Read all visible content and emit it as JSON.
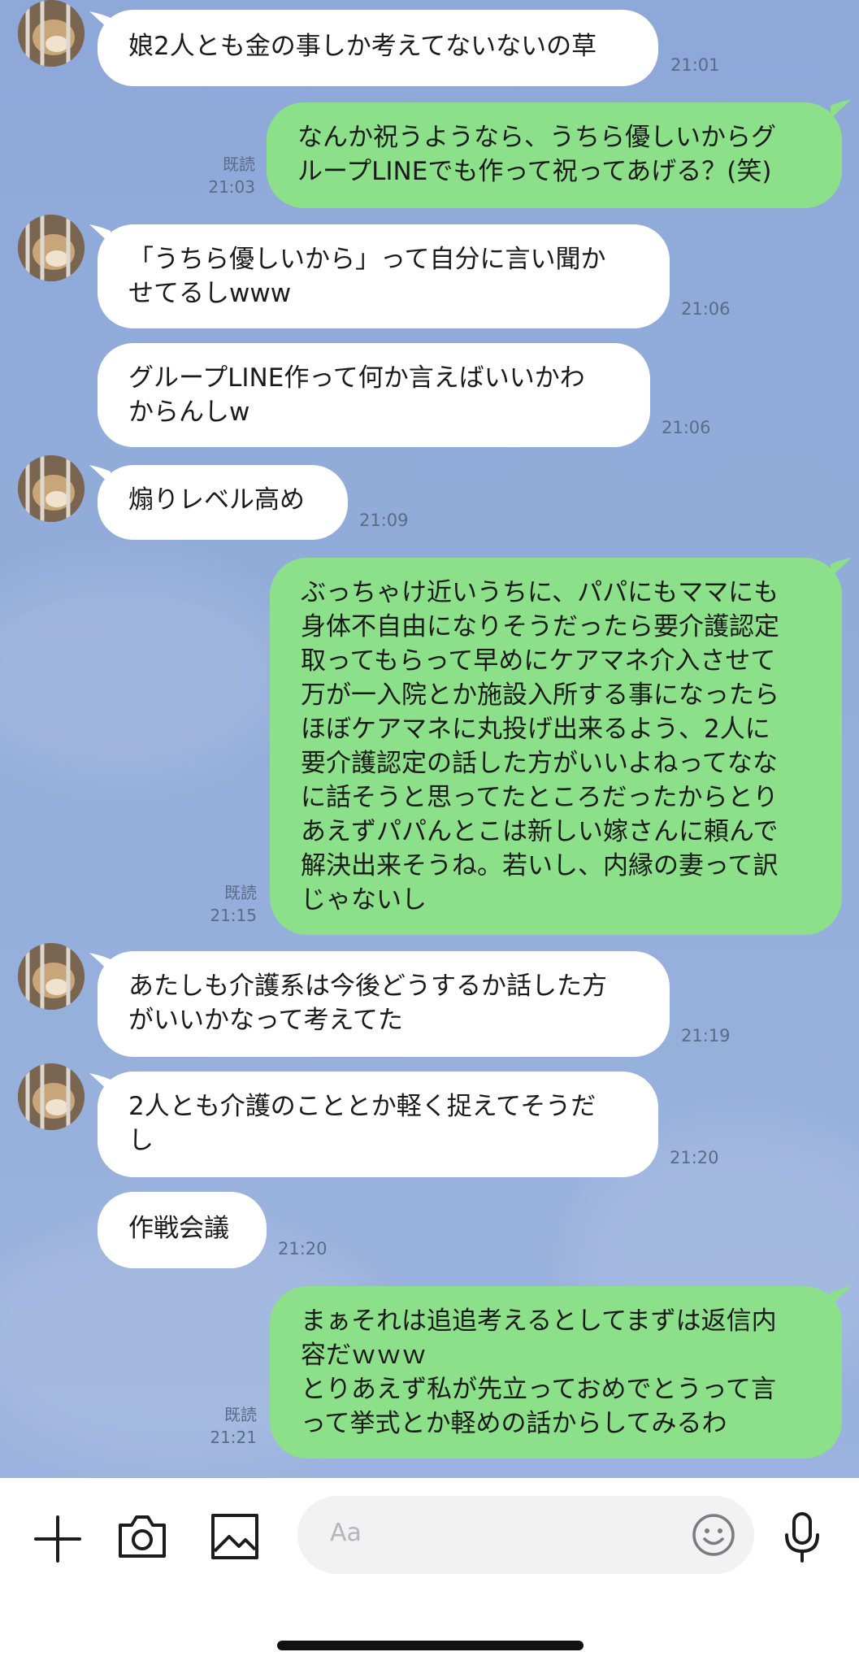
{
  "messages": [
    {
      "side": "in",
      "text": "娘2人とも金の事しか考えてないないの草",
      "time": "21:01"
    },
    {
      "side": "out",
      "text": "なんか祝うようなら、うちら優しいからグ\nループLINEでも作って祝ってあげる？(笑)",
      "read": "既読",
      "time": "21:03"
    },
    {
      "side": "in",
      "text": "「うちら優しいから」って自分に言い聞か\nせてるしwww",
      "time": "21:06"
    },
    {
      "side": "in",
      "text": "グループLINE作って何か言えばいいかわ\nからんしw",
      "time": "21:06"
    },
    {
      "side": "in",
      "text": "煽りレベル高め",
      "time": "21:09"
    },
    {
      "side": "out",
      "text": "ぶっちゃけ近いうちに、パパにもママにも\n身体不自由になりそうだったら要介護認定\n取ってもらって早めにケアマネ介入させて\n万が一入院とか施設入所する事になったら\nほぼケアマネに丸投げ出来るよう、2人に\n要介護認定の話した方がいいよねってなな\nに話そうと思ってたところだったからとり\nあえずパパんとこは新しい嫁さんに頼んで\n解決出来そうね。若いし、内縁の妻って訳\nじゃないし",
      "read": "既読",
      "time": "21:15"
    },
    {
      "side": "in",
      "text": "あたしも介護系は今後どうするか話した方\nがいいかなって考えてた",
      "time": "21:19"
    },
    {
      "side": "in",
      "text": "2人とも介護のこととか軽く捉えてそうだ\nし",
      "time": "21:20"
    },
    {
      "side": "in",
      "text": "作戦会議",
      "time": "21:20"
    },
    {
      "side": "out",
      "text": "まぁそれは追追考えるとしてまずは返信内\n容だｗｗｗ\nとりあえず私が先立っておめでとうって言\nって挙式とか軽めの話からしてみるわ",
      "read": "既読",
      "time": "21:21"
    }
  ],
  "input": {
    "placeholder": "Aa"
  },
  "icons": {
    "add": "plus-icon",
    "camera": "camera-icon",
    "image": "image-icon",
    "emoji": "emoji-icon",
    "mic": "microphone-icon"
  },
  "colors": {
    "background": "#8fa9d8",
    "incoming_bubble": "#ffffff",
    "outgoing_bubble": "#8de08a",
    "meta_text": "#5c6b85"
  }
}
